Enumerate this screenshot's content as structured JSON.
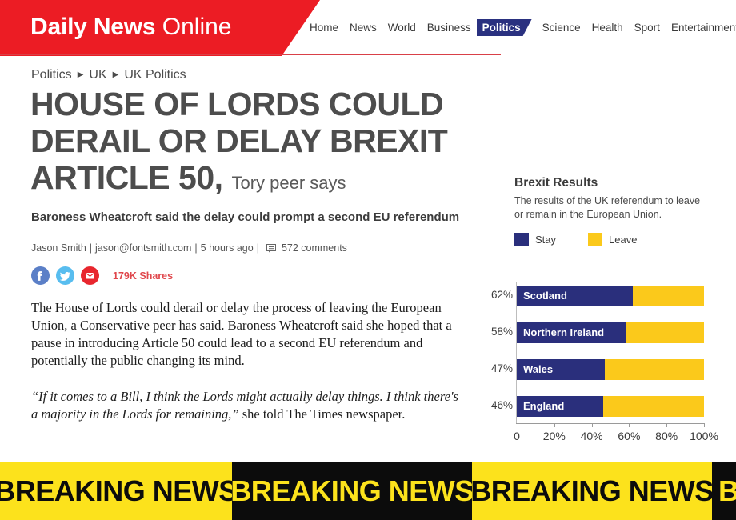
{
  "site": {
    "logo_bold": "Daily News",
    "logo_light": "Online",
    "brand_red": "#EC1C24",
    "nav": [
      {
        "label": "Home",
        "active": false
      },
      {
        "label": "News",
        "active": false
      },
      {
        "label": "World",
        "active": false
      },
      {
        "label": "Business",
        "active": false
      },
      {
        "label": "Politics",
        "active": true
      },
      {
        "label": "Science",
        "active": false
      },
      {
        "label": "Health",
        "active": false
      },
      {
        "label": "Sport",
        "active": false
      },
      {
        "label": "Entertainment",
        "active": false
      }
    ]
  },
  "breadcrumb": {
    "items": [
      "Politics",
      "UK",
      "UK Politics"
    ],
    "separator": "▶"
  },
  "article": {
    "headline_main": "HOUSE OF LORDS COULD DERAIL OR DELAY BREXIT ARTICLE 50,",
    "headline_kicker": "Tory peer says",
    "subhead": "Baroness Wheatcroft said the delay could prompt a second EU referendum",
    "author": "Jason Smith",
    "email": "jason@fontsmith.com",
    "time": "5 hours ago",
    "comments": "572 comments",
    "byline_sep": "|",
    "shares": "179K Shares",
    "social": [
      {
        "name": "facebook-icon",
        "color": "#5B7FC7",
        "glyph": "f"
      },
      {
        "name": "twitter-icon",
        "color": "#58BDEF",
        "glyph": "t"
      },
      {
        "name": "email-icon",
        "color": "#E8262E",
        "glyph": "e"
      }
    ],
    "body": "The House of Lords could derail or delay the process of leaving the European Union, a Conservative peer has said. Baroness Wheatcroft said she hoped that a pause in introducing Article 50 could lead to a second EU referendum and potentially the public changing its mind.",
    "quote_italic": "“If it comes to a Bill, I think the Lords might actually delay things. I think there's a majority in the Lords for remaining,”",
    "quote_tail": " she told The Times newspaper."
  },
  "chart_data": {
    "type": "bar",
    "title": "Brexit Results",
    "subtitle": "The results of the UK referendum to leave or remain in the European Union.",
    "orientation": "horizontal",
    "stacked": true,
    "categories": [
      "Scotland",
      "Northern Ireland",
      "Wales",
      "England"
    ],
    "series": [
      {
        "name": "Stay",
        "color": "#2A2F7C",
        "values": [
          62,
          58,
          47,
          46
        ]
      },
      {
        "name": "Leave",
        "color": "#FBC91B",
        "values": [
          38,
          42,
          53,
          54
        ]
      }
    ],
    "value_labels": [
      "62%",
      "58%",
      "47%",
      "46%"
    ],
    "xlabel": "",
    "ylabel": "",
    "xlim": [
      0,
      100
    ],
    "xticks": [
      0,
      20,
      40,
      60,
      80,
      100
    ],
    "xticklabels": [
      "0",
      "20%",
      "40%",
      "60%",
      "80%",
      "100%"
    ],
    "grid": false,
    "legend_position": "top"
  },
  "ticker": {
    "text": "BREAKING NEWS",
    "segments": [
      {
        "style": "yellow"
      },
      {
        "style": "black"
      },
      {
        "style": "yellow"
      },
      {
        "style": "black"
      }
    ]
  }
}
